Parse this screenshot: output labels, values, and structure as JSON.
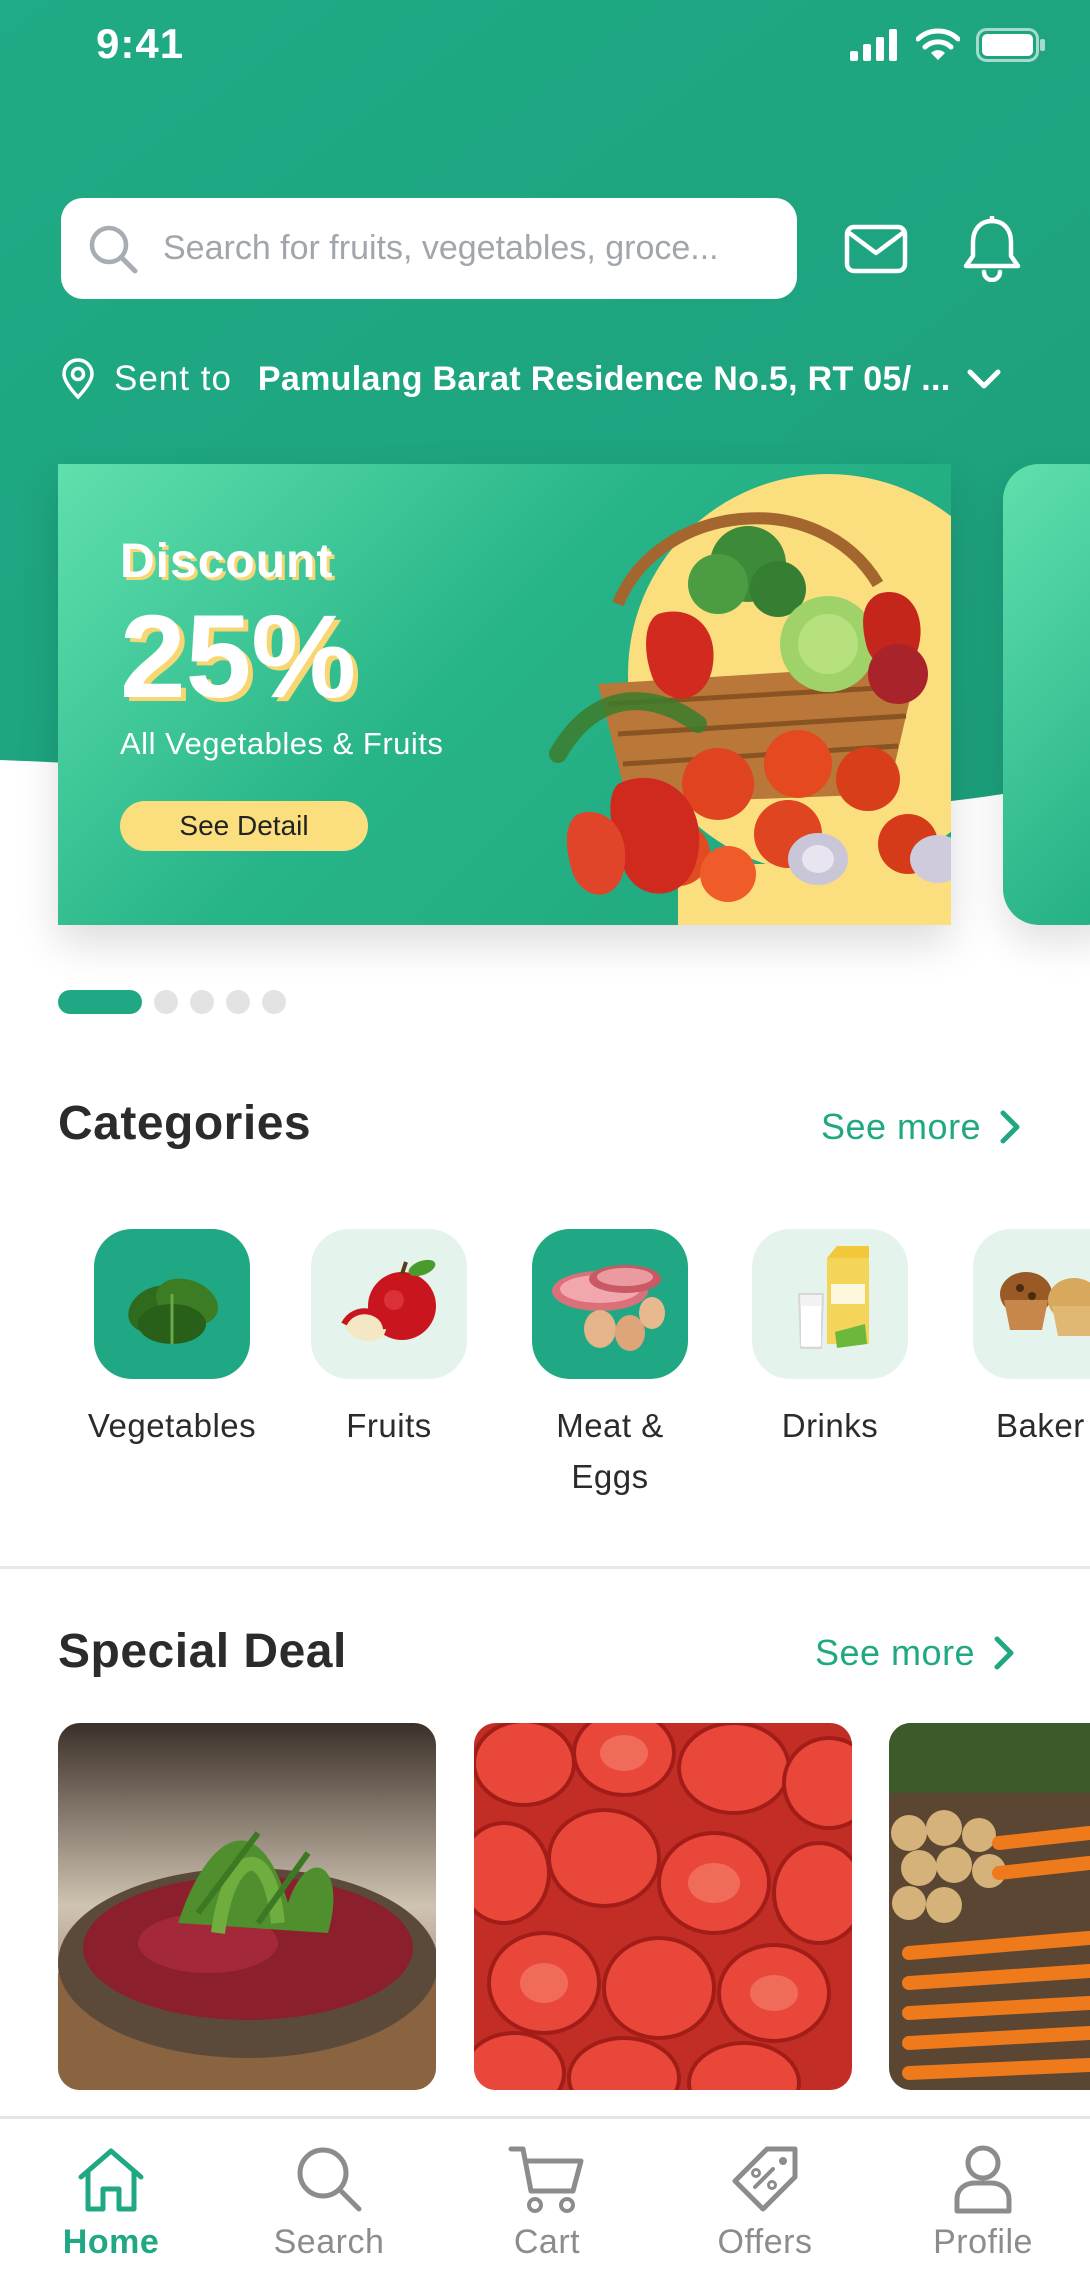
{
  "status_bar": {
    "time": "9:41"
  },
  "search": {
    "placeholder": "Search for fruits, vegetables, groce..."
  },
  "delivery": {
    "label": "Sent to",
    "address": "Pamulang Barat Residence No.5, RT 05/ ..."
  },
  "banner": {
    "title": "Discount",
    "percent": "25%",
    "subtitle": "All Vegetables & Fruits",
    "button_label": "See Detail",
    "slide_count": 5,
    "active_slide": 1
  },
  "categories": {
    "title": "Categories",
    "see_more": "See more",
    "items": [
      {
        "label": "Vegetables",
        "label_line2": "",
        "icon": "spinach-icon"
      },
      {
        "label": "Fruits",
        "label_line2": "",
        "icon": "apple-icon"
      },
      {
        "label": "Meat &",
        "label_line2": "Eggs",
        "icon": "meat-eggs-icon"
      },
      {
        "label": "Drinks",
        "label_line2": "",
        "icon": "milk-icon"
      },
      {
        "label": "Baker",
        "label_line2": "",
        "icon": "muffin-icon"
      }
    ]
  },
  "special_deal": {
    "title": "Special Deal",
    "see_more": "See more"
  },
  "tabs": [
    {
      "label": "Home",
      "icon": "home-icon",
      "active": true
    },
    {
      "label": "Search",
      "icon": "search-icon",
      "active": false
    },
    {
      "label": "Cart",
      "icon": "cart-icon",
      "active": false
    },
    {
      "label": "Offers",
      "icon": "offer-tag-icon",
      "active": false
    },
    {
      "label": "Profile",
      "icon": "profile-icon",
      "active": false
    }
  ],
  "colors": {
    "brand": "#1FA883",
    "accent": "#FBDF7E",
    "light_tile": "#E4F4EC"
  }
}
